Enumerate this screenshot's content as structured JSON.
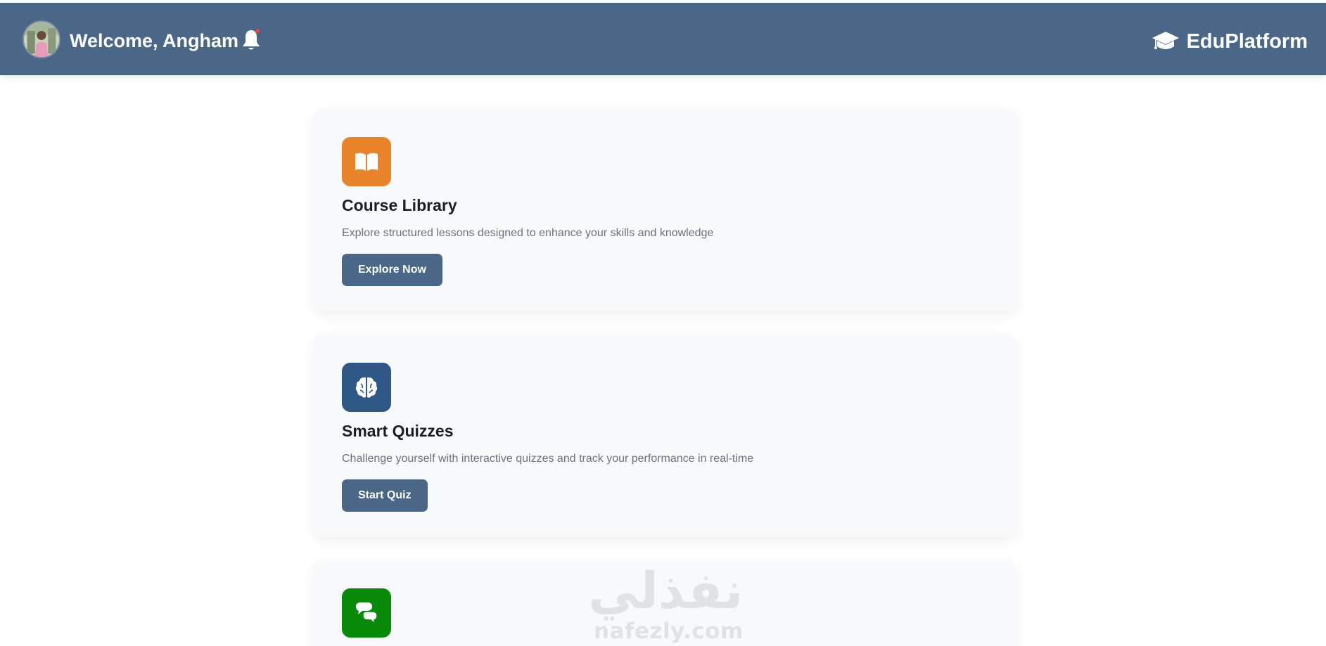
{
  "header": {
    "welcome_text": "Welcome, Angham",
    "brand_name": "EduPlatform",
    "notification_indicator": true,
    "colors": {
      "background": "#4a6787",
      "text": "#ffffff",
      "notification_dot": "#ff3b3b"
    }
  },
  "cards": [
    {
      "icon": "open-book-icon",
      "icon_color": "#e8832a",
      "title": "Course Library",
      "description": "Explore structured lessons designed to enhance your skills and knowledge",
      "button_label": "Explore Now"
    },
    {
      "icon": "brain-icon",
      "icon_color": "#2d5785",
      "title": "Smart Quizzes",
      "description": "Challenge yourself with interactive quizzes and track your performance in real-time",
      "button_label": "Start Quiz"
    },
    {
      "icon": "chat-bubbles-icon",
      "icon_color": "#098a09"
    }
  ],
  "watermark": {
    "script_text": "نفذلي",
    "latin_text": "nafezly.com"
  },
  "colors": {
    "page_background": "#ffffff",
    "card_background": "#f7f9fb",
    "button_background": "#4a6787",
    "title_text": "#1b1f24",
    "description_text": "#69727d"
  }
}
